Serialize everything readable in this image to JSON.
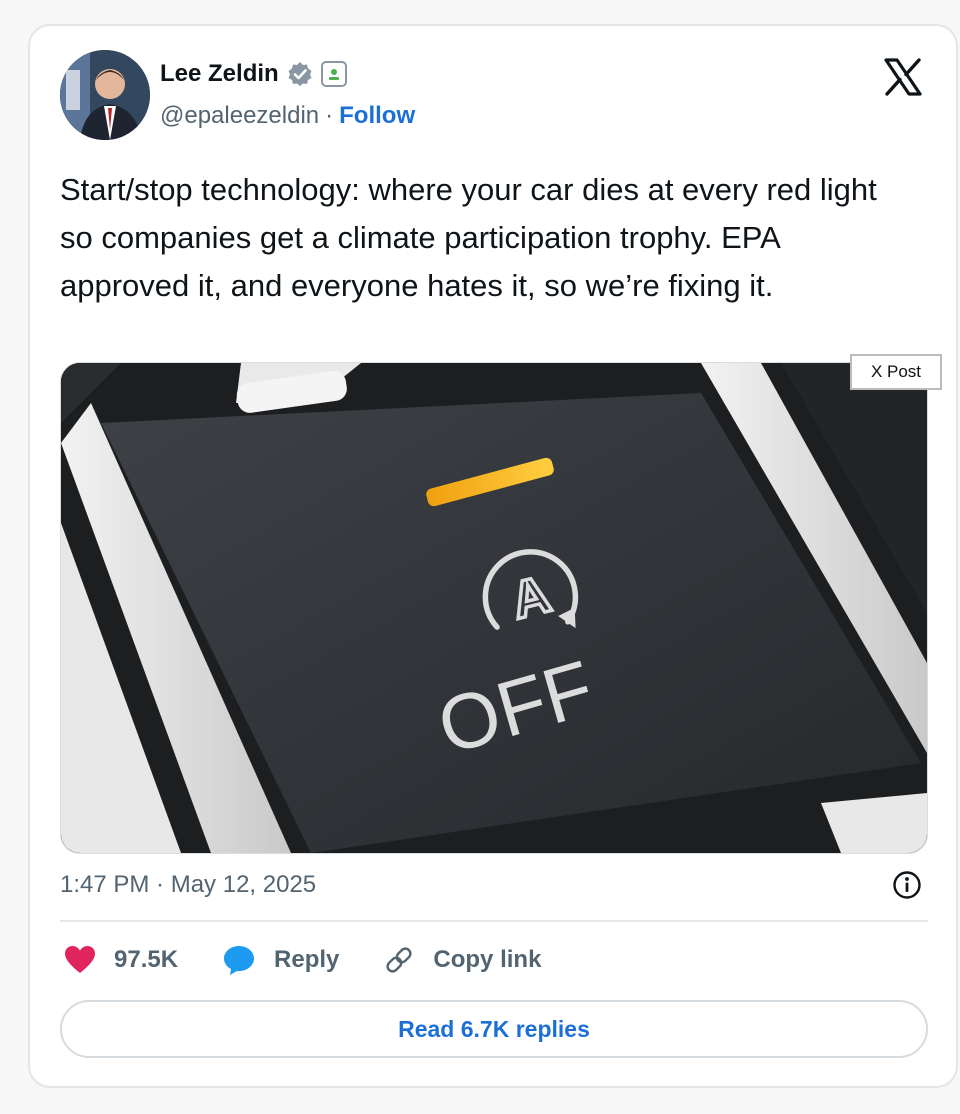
{
  "author": {
    "name": "Lee Zeldin",
    "handle": "@epaleezeldin",
    "separator": "·",
    "follow_label": "Follow"
  },
  "tweet": {
    "text": "Start/stop technology: where your car dies at every red light so companies get a climate participation trophy. EPA approved it, and everyone hates it, so we’re fixing it.",
    "timestamp": "1:47 PM · May 12, 2025"
  },
  "media": {
    "tag": "X Post",
    "button_text": "OFF",
    "button_glyph": "A",
    "indicator_color": "#f5a623"
  },
  "actions": {
    "likes": "97.5K",
    "reply_label": "Reply",
    "copy_label": "Copy link"
  },
  "read_replies_label": "Read 6.7K replies",
  "colors": {
    "accent": "#1d6fd8",
    "like": "#e0245e",
    "reply": "#1d9bf0"
  }
}
